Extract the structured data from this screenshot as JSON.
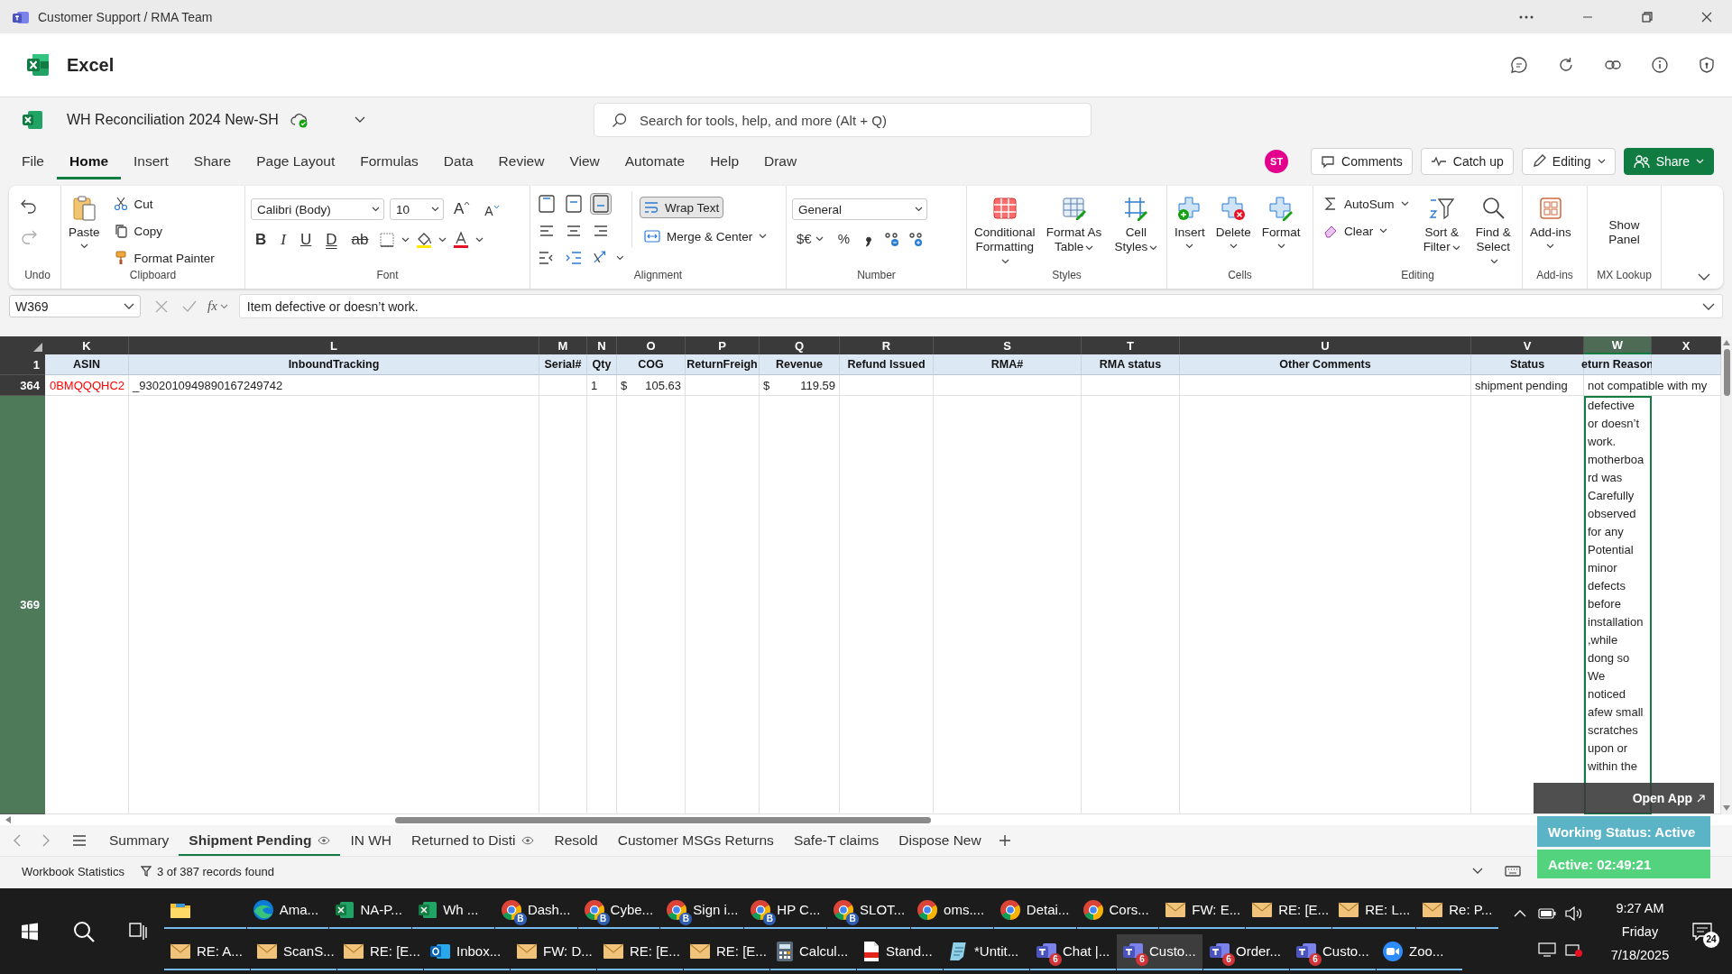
{
  "window": {
    "title": "Customer Support / RMA Team"
  },
  "app": {
    "name": "Excel"
  },
  "document": {
    "name": "WH Reconciliation 2024 New-SH"
  },
  "search": {
    "placeholder": "Search for tools, help, and more (Alt + Q)"
  },
  "menu_tabs": [
    {
      "label": "File",
      "selected": false
    },
    {
      "label": "Home",
      "selected": true
    },
    {
      "label": "Insert",
      "selected": false
    },
    {
      "label": "Share",
      "selected": false
    },
    {
      "label": "Page Layout",
      "selected": false
    },
    {
      "label": "Formulas",
      "selected": false
    },
    {
      "label": "Data",
      "selected": false
    },
    {
      "label": "Review",
      "selected": false
    },
    {
      "label": "View",
      "selected": false
    },
    {
      "label": "Automate",
      "selected": false
    },
    {
      "label": "Help",
      "selected": false
    },
    {
      "label": "Draw",
      "selected": false
    }
  ],
  "user": {
    "initials": "ST"
  },
  "actions": [
    {
      "kind": "comments",
      "label": "Comments"
    },
    {
      "kind": "catchup",
      "label": "Catch up"
    },
    {
      "kind": "editing",
      "label": "Editing"
    },
    {
      "kind": "share",
      "label": "Share"
    }
  ],
  "ribbon": {
    "undo": {
      "label": "Undo"
    },
    "clipboard": {
      "label": "Clipboard",
      "paste": "Paste",
      "cut": "Cut",
      "copy": "Copy",
      "format_painter": "Format Painter"
    },
    "font": {
      "label": "Font",
      "family": "Calibri (Body)",
      "size": "10",
      "grow": "A",
      "shrink": "A",
      "styles": [
        "B",
        "I",
        "U",
        "D",
        "ab"
      ]
    },
    "alignment": {
      "label": "Alignment",
      "vertical": [
        {
          "selected": false
        },
        {
          "selected": false
        },
        {
          "selected": true
        }
      ],
      "wrap_text": {
        "label": "Wrap Text",
        "on": true
      },
      "merge": "Merge & Center"
    },
    "number": {
      "label": "Number",
      "format": "General",
      "currency": "$€",
      "percent": "%"
    },
    "styles": {
      "label": "Styles",
      "buttons": [
        "Conditional Formatting",
        "Format As Table",
        "Cell Styles"
      ]
    },
    "cells": {
      "label": "Cells",
      "buttons": [
        "Insert",
        "Delete",
        "Format"
      ]
    },
    "editing": {
      "label": "Editing",
      "autosum": "AutoSum",
      "clear": "Clear",
      "sort": "Sort & Filter",
      "find": "Find & Select"
    },
    "addins": {
      "label": "Add-ins",
      "button": "Add-ins"
    },
    "mx_lookup": {
      "label": "MX Lookup",
      "button": "Show Panel"
    }
  },
  "formula_bar": {
    "name_box": "W369",
    "fx": "fx",
    "formula": "Item defective or doesn’t work."
  },
  "sheet": {
    "columns": [
      {
        "letter": "K",
        "header": "ASIN",
        "selected": false
      },
      {
        "letter": "L",
        "header": "InboundTracking",
        "selected": false
      },
      {
        "letter": "M",
        "header": "Serial#",
        "selected": false
      },
      {
        "letter": "N",
        "header": "Qty",
        "selected": false
      },
      {
        "letter": "O",
        "header": "COG",
        "selected": false
      },
      {
        "letter": "P",
        "header": "ReturnFreigh",
        "selected": false
      },
      {
        "letter": "Q",
        "header": "Revenue",
        "selected": false
      },
      {
        "letter": "R",
        "header": "Refund Issued",
        "selected": false
      },
      {
        "letter": "S",
        "header": "RMA#",
        "selected": false
      },
      {
        "letter": "T",
        "header": "RMA status",
        "selected": false
      },
      {
        "letter": "U",
        "header": "Other Comments",
        "selected": false
      },
      {
        "letter": "V",
        "header": "Status",
        "selected": false
      },
      {
        "letter": "W",
        "header": "eturn Reason",
        "selected": true
      },
      {
        "letter": "X",
        "selected": false
      }
    ],
    "header_row": "1",
    "rows": [
      {
        "number": "364",
        "selected": false,
        "cells": {
          "K": {
            "text": "0BMQQQHC2",
            "color": "#ff0000"
          },
          "L": {
            "text": "_9302010949890167249742"
          },
          "N": {
            "text": "1"
          },
          "O": {
            "text": "105.63",
            "currency": "$"
          },
          "Q": {
            "text": "119.59",
            "currency": "$"
          },
          "V": {
            "text": "shipment pending"
          },
          "W": {
            "text": "not compatible with my"
          }
        }
      },
      {
        "number": "369",
        "selected": true,
        "cells": {
          "W": {
            "text": "defective or doesn’t work. motherboard was Carefully observed for any Potential minor defects before installation,while dong so We noticed afew small scratches upon or within the",
            "selected": true
          }
        }
      }
    ]
  },
  "sheet_tabs": [
    {
      "label": "Summary",
      "selected": false,
      "shared": false
    },
    {
      "label": "Shipment Pending",
      "selected": true,
      "shared": true
    },
    {
      "label": "IN WH",
      "selected": false,
      "shared": false
    },
    {
      "label": "Returned to Disti",
      "selected": false,
      "shared": true
    },
    {
      "label": "Resold",
      "selected": false,
      "shared": false
    },
    {
      "label": "Customer MSGs Returns",
      "selected": false,
      "shared": false
    },
    {
      "label": "Safe-T claims",
      "selected": false,
      "shared": false
    },
    {
      "label": "Dispose New",
      "selected": false,
      "shared": false
    }
  ],
  "status_bar": {
    "statistics": "Workbook Statistics",
    "records": "3 of 387 records found"
  },
  "overlay": {
    "open_app": "Open App",
    "working_status": "Working Status: Active",
    "active_timer": "Active: 02:49:21"
  },
  "taskbar": {
    "rows": [
      [
        {
          "kind": "explorer",
          "active": false
        },
        {
          "kind": "edge",
          "label": "Ama...",
          "active": false
        },
        {
          "kind": "excel",
          "label": "NA-P...",
          "active": false
        },
        {
          "kind": "excel",
          "label": "Wh ...",
          "active": false
        },
        {
          "kind": "chrome",
          "label": "Dash...",
          "badge": "B",
          "active": false
        },
        {
          "kind": "chrome",
          "label": "Cybe...",
          "badge": "B",
          "active": false
        },
        {
          "kind": "chrome",
          "label": "Sign i...",
          "badge": "B",
          "active": false
        },
        {
          "kind": "chrome",
          "label": "HP C...",
          "badge": "B",
          "active": false
        },
        {
          "kind": "chrome",
          "label": "SLOT...",
          "badge": "B",
          "active": false
        },
        {
          "kind": "chrome",
          "label": "oms....",
          "active": false
        },
        {
          "kind": "chrome",
          "label": "Detai...",
          "active": false
        },
        {
          "kind": "chrome",
          "label": "Cors...",
          "active": false
        },
        {
          "kind": "mail",
          "label": "FW: E...",
          "active": false
        },
        {
          "kind": "mail",
          "label": "RE: [E...",
          "active": false
        },
        {
          "kind": "mail",
          "label": "RE: L...",
          "active": false
        },
        {
          "kind": "mail",
          "label": "Re: P...",
          "active": false
        }
      ],
      [
        {
          "kind": "mail",
          "label": "RE: A...",
          "active": false
        },
        {
          "kind": "mail",
          "label": "ScanS...",
          "active": false
        },
        {
          "kind": "mail",
          "label": "RE: [E...",
          "active": false
        },
        {
          "kind": "outlook",
          "label": "Inbox...",
          "active": false
        },
        {
          "kind": "mail",
          "label": "FW: D...",
          "active": false
        },
        {
          "kind": "mail",
          "label": "RE: [E...",
          "active": false
        },
        {
          "kind": "mail",
          "label": "RE: [E...",
          "active": false
        },
        {
          "kind": "calc",
          "label": "Calcul...",
          "active": false
        },
        {
          "kind": "pdf",
          "label": "Stand...",
          "active": false
        },
        {
          "kind": "notepad",
          "label": "*Untit...",
          "active": false
        },
        {
          "kind": "teams",
          "label": "Chat |...",
          "badge": "6",
          "active": false
        },
        {
          "kind": "teams",
          "label": "Custo...",
          "badge": "6",
          "active": true
        },
        {
          "kind": "teams",
          "label": "Order...",
          "badge": "6",
          "active": false
        },
        {
          "kind": "teams",
          "label": "Custo...",
          "badge": "6",
          "active": false
        },
        {
          "kind": "zoom",
          "label": "Zoo...",
          "active": false
        }
      ]
    ],
    "clock": {
      "time": "9:27 AM",
      "day": "Friday",
      "date": "7/18/2025"
    },
    "notifications": "24"
  }
}
